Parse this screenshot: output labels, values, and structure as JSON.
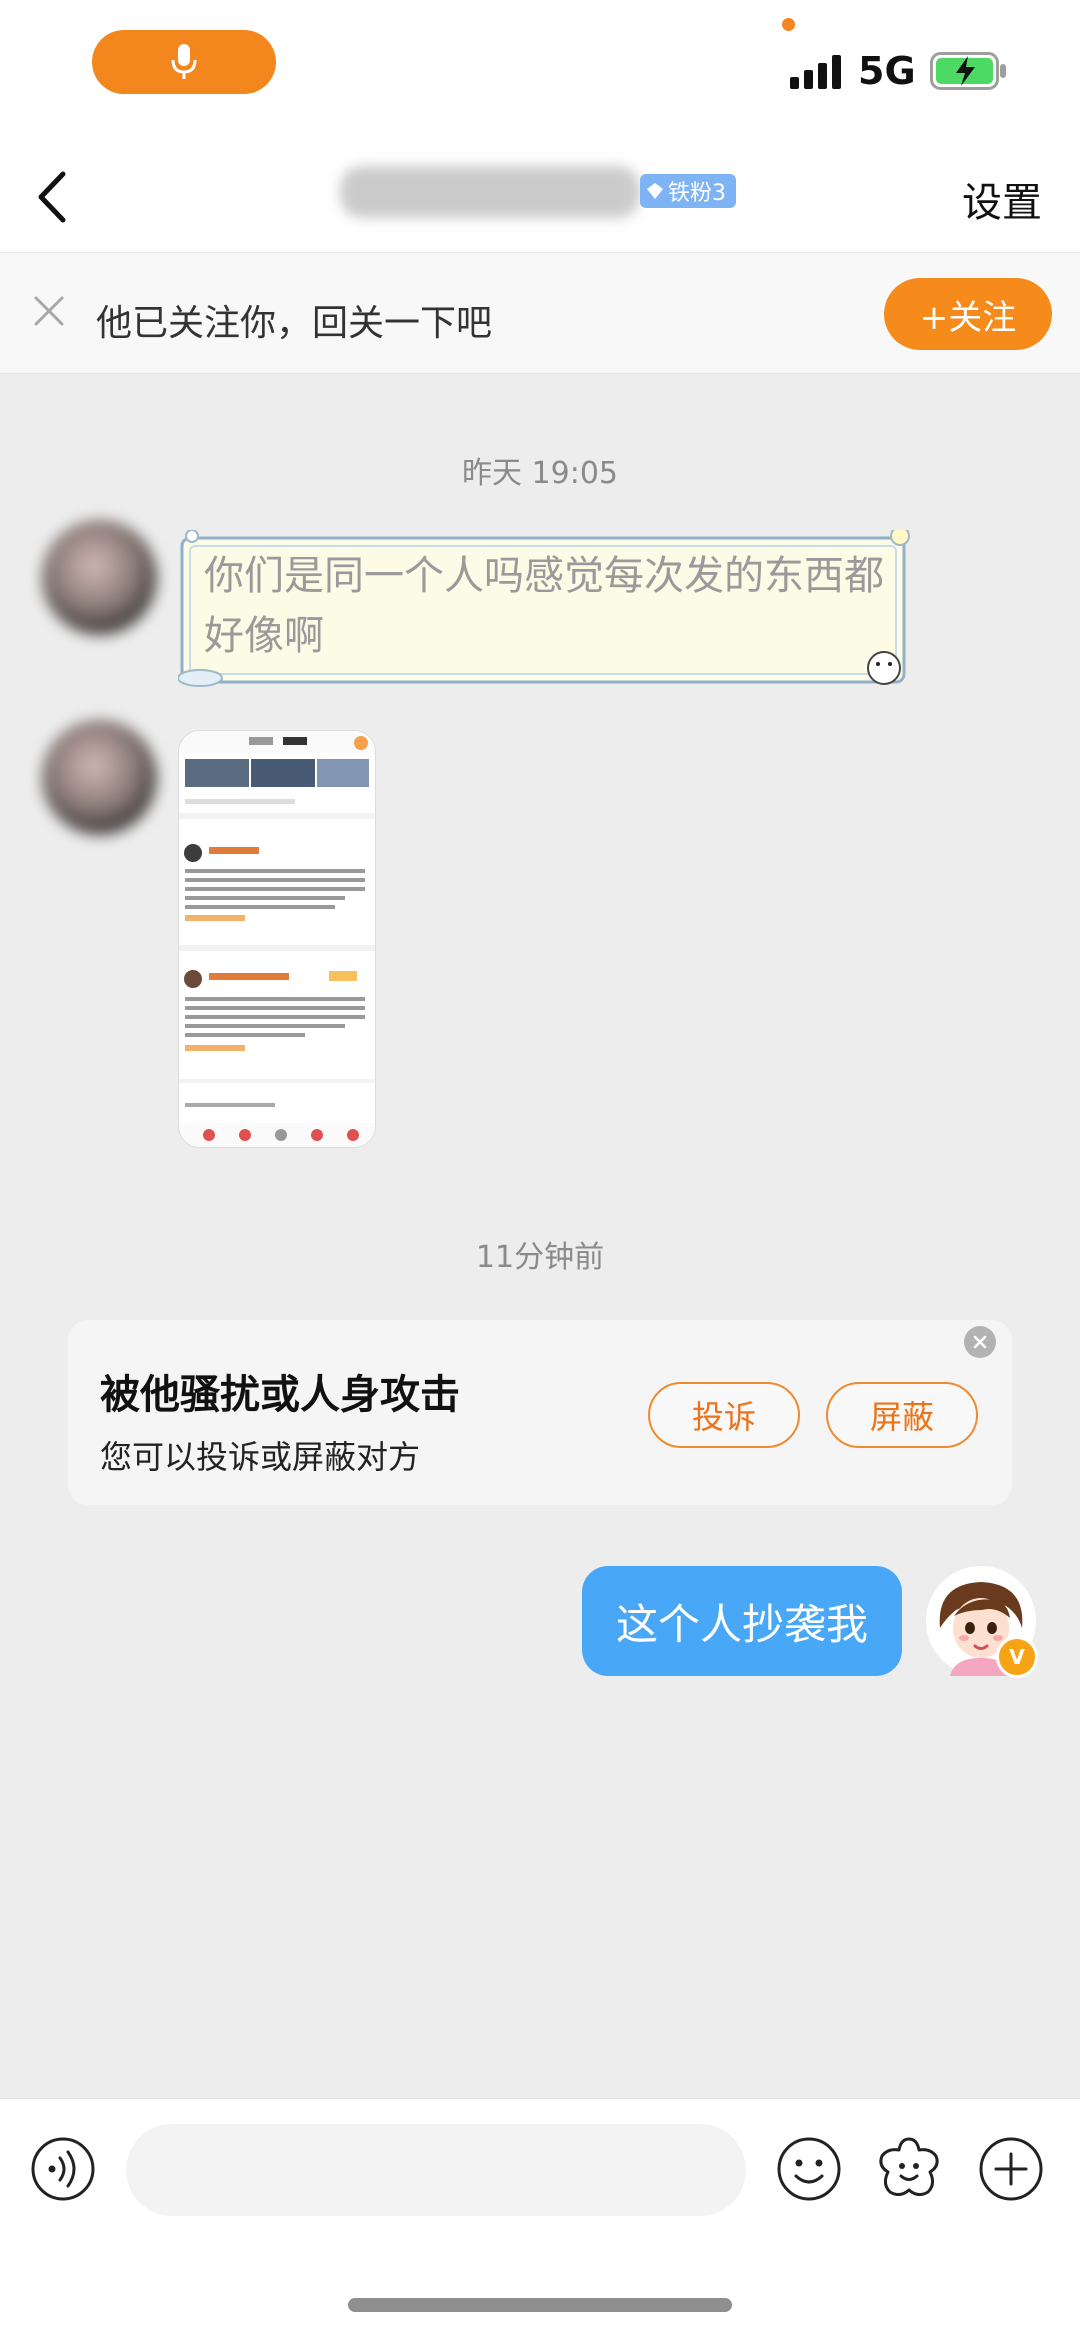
{
  "status": {
    "network": "5G",
    "icons": [
      "microphone-icon",
      "signal-icon",
      "battery-charging-icon"
    ]
  },
  "nav": {
    "back_icon": "chevron-left-icon",
    "fan_badge": "铁粉3",
    "settings": "设置"
  },
  "follow_banner": {
    "text": "他已关注你，回关一下吧",
    "button": "+关注"
  },
  "messages": {
    "timestamp_1": "昨天 19:05",
    "incoming_1": "你们是同一个人吗感觉每次发的东西都好像啊",
    "timestamp_2": "11分钟前",
    "outgoing_1": "这个人抄袭我"
  },
  "harass_card": {
    "title": "被他骚扰或人身攻击",
    "subtitle": "您可以投诉或屏蔽对方",
    "complain": "投诉",
    "block": "屏蔽"
  },
  "input_bar": {
    "placeholder": "",
    "icons": [
      "voice-icon",
      "emoji-icon",
      "sticker-icon",
      "plus-icon"
    ]
  },
  "colors": {
    "accent": "#f68a1b",
    "outgoing_bubble": "#48a8f7",
    "background": "#ededed"
  }
}
